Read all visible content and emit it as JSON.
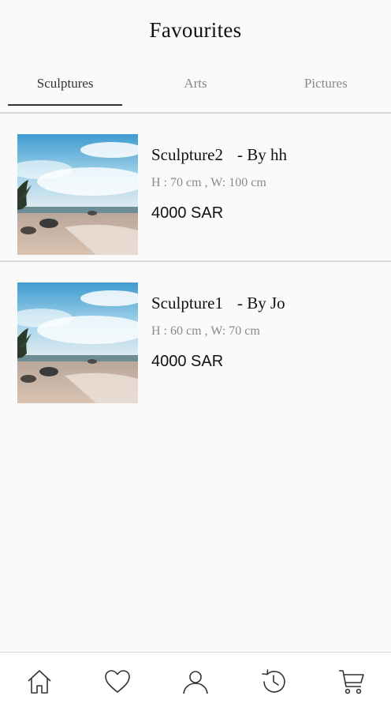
{
  "header": {
    "title": "Favourites"
  },
  "tabs": [
    {
      "label": "Sculptures",
      "active": true
    },
    {
      "label": "Arts",
      "active": false
    },
    {
      "label": "Pictures",
      "active": false
    }
  ],
  "items": [
    {
      "name": "Sculpture2",
      "author": "- By hh",
      "dims": "H : 70 cm , W: 100 cm",
      "price": "4000 SAR"
    },
    {
      "name": "Sculpture1",
      "author": "- By Jo",
      "dims": "H : 60 cm , W: 70 cm",
      "price": "4000 SAR"
    }
  ],
  "bottom_nav": [
    "home-icon",
    "heart-icon",
    "user-icon",
    "history-icon",
    "cart-icon"
  ],
  "colors": {
    "text": "#111111",
    "muted": "#888888",
    "divider": "#d9d9d9",
    "background": "#fafafa"
  }
}
